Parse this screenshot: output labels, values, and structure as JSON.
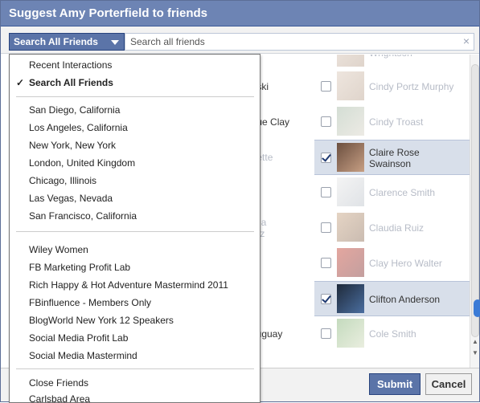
{
  "dialog": {
    "title": "Suggest Amy Porterfield to friends"
  },
  "search": {
    "filter_label": "Search All Friends",
    "placeholder": "Search all friends",
    "clear_icon": "×"
  },
  "dropdown": {
    "check_glyph": "✓",
    "group1": [
      "Recent Interactions",
      "Search All Friends"
    ],
    "checked_item": "Search All Friends",
    "group2": [
      "San Diego, California",
      "Los Angeles, California",
      "New York, New York",
      "London, United Kingdom",
      "Chicago, Illinois",
      "Las Vegas, Nevada",
      "San Francisco, California"
    ],
    "group3": [
      "Wiley Women",
      "FB Marketing Profit Lab",
      "Rich Happy & Hot Adventure Mastermind 2011",
      "FBinfluence - Members Only",
      "BlogWorld New York 12 Speakers",
      "Social Media Profit Lab",
      "Social Media Mastermind"
    ],
    "group4": [
      "Close Friends",
      "Carlsbad Area"
    ]
  },
  "friends_left": [
    "",
    "enski",
    "ague Clay",
    "ouette",
    "ter",
    "liana\narez",
    "ns",
    "ms",
    "Uruguay"
  ],
  "friends_right": [
    "Wrightson",
    "Cindy Portz Murphy",
    "Cindy Troast",
    "Claire Rose\nSwainson",
    "Clarence Smith",
    "Claudia Ruiz",
    "Clay Hero Walter",
    "Clifton Anderson",
    "Cole Smith"
  ],
  "selected_friends": [
    "Claire Rose Swainson",
    "Clifton Anderson"
  ],
  "footer": {
    "submit_label": "Submit",
    "cancel_label": "Cancel"
  },
  "colors": {
    "title_bar": "#6d84b4",
    "button_blue": "#5b74a8",
    "selected_row": "#d8dfea"
  }
}
